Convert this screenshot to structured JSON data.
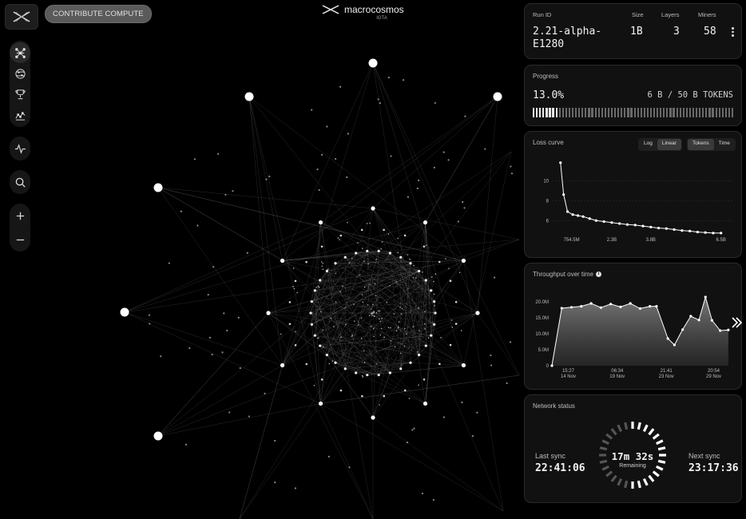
{
  "header": {
    "contribute_label": "CONTRIBUTE COMPUTE",
    "brand_name": "macrocosmos",
    "brand_sub": "IOTA"
  },
  "rail": {
    "icons": [
      "network-icon",
      "globe-icon",
      "trophy-icon",
      "chart-icon",
      "activity-icon",
      "search-icon",
      "zoom-in-icon",
      "zoom-out-icon"
    ]
  },
  "run": {
    "id_label": "Run ID",
    "id": "2.21-alpha-E1280",
    "id_line1": "2.21-alpha-",
    "id_line2": "E1280",
    "size_label": "Size",
    "size": "1B",
    "layers_label": "Layers",
    "layers": "3",
    "miners_label": "Miners",
    "miners": "58"
  },
  "progress": {
    "title": "Progress",
    "percent_text": "13.0%",
    "percent": 0.13,
    "tokens_text": "6 B / 50 B TOKENS"
  },
  "loss": {
    "title": "Loss curve",
    "scale_options": [
      "Log",
      "Linear"
    ],
    "scale_selected": "Linear",
    "axis_options": [
      "Tokens",
      "Time"
    ],
    "axis_selected": "Tokens"
  },
  "throughput": {
    "title": "Throughput over time",
    "info": "i"
  },
  "status": {
    "title": "Network status",
    "last_label": "Last sync",
    "last_time": "22:41:06",
    "remaining": "17m 32s",
    "remaining_label": "Remaining",
    "next_label": "Next sync",
    "next_time": "23:17:36",
    "remaining_fraction": 0.52
  },
  "colors": {
    "accent": "#ffffff",
    "panel": "#111111",
    "border": "#2a2a2a"
  },
  "chart_data": [
    {
      "type": "line",
      "title": "Loss curve",
      "x": [
        0.33,
        0.45,
        0.6,
        0.8,
        1.0,
        1.2,
        1.45,
        1.7,
        2.0,
        2.3,
        2.6,
        2.9,
        3.2,
        3.5,
        3.8,
        4.1,
        4.4,
        4.7,
        5.0,
        5.3,
        5.6,
        5.9,
        6.2,
        6.5
      ],
      "values": [
        11.8,
        8.6,
        6.9,
        6.6,
        6.5,
        6.4,
        6.2,
        6.0,
        5.9,
        5.8,
        5.7,
        5.6,
        5.55,
        5.45,
        5.35,
        5.25,
        5.2,
        5.1,
        5.0,
        4.95,
        4.85,
        4.8,
        4.75,
        4.75
      ],
      "x_ticks": [
        {
          "v": 0.7545,
          "label": "754.5M"
        },
        {
          "v": 2.3,
          "label": "2.3B"
        },
        {
          "v": 3.8,
          "label": "3.8B"
        },
        {
          "v": 6.5,
          "label": "6.5B"
        }
      ],
      "y_ticks": [
        6,
        8,
        10
      ],
      "xlim": [
        0.0,
        7.0
      ],
      "ylim": [
        4.5,
        12.5
      ],
      "grid": true
    },
    {
      "type": "area",
      "title": "Throughput over time",
      "x": [
        0,
        0.3,
        0.6,
        0.9,
        1.2,
        1.5,
        1.8,
        2.1,
        2.4,
        2.7,
        3.0,
        3.2,
        3.55,
        3.75,
        4.0,
        4.25,
        4.5,
        4.7,
        4.9,
        5.15,
        5.4
      ],
      "values": [
        0,
        18.0,
        18.3,
        18.6,
        19.5,
        18.2,
        19.3,
        18.4,
        19.5,
        17.9,
        18.6,
        18.6,
        8.5,
        6.5,
        11.3,
        15.5,
        14.3,
        21.5,
        14.2,
        11.0,
        11.2
      ],
      "x_ticks": [
        {
          "v": 0.5,
          "label": "15:27",
          "label2": "14 Nov"
        },
        {
          "v": 2.0,
          "label": "06:34",
          "label2": "19 Nov"
        },
        {
          "v": 3.5,
          "label": "21:41",
          "label2": "23 Nov"
        },
        {
          "v": 4.95,
          "label": "20:54",
          "label2": "29 Nov"
        }
      ],
      "y_ticks": [
        {
          "v": 0,
          "label": "0"
        },
        {
          "v": 5,
          "label": "5.0M"
        },
        {
          "v": 10,
          "label": "10.0M"
        },
        {
          "v": 15,
          "label": "15.0M"
        },
        {
          "v": 20,
          "label": "20.0M"
        }
      ],
      "xlim": [
        0,
        5.5
      ],
      "ylim": [
        0,
        22
      ]
    }
  ]
}
